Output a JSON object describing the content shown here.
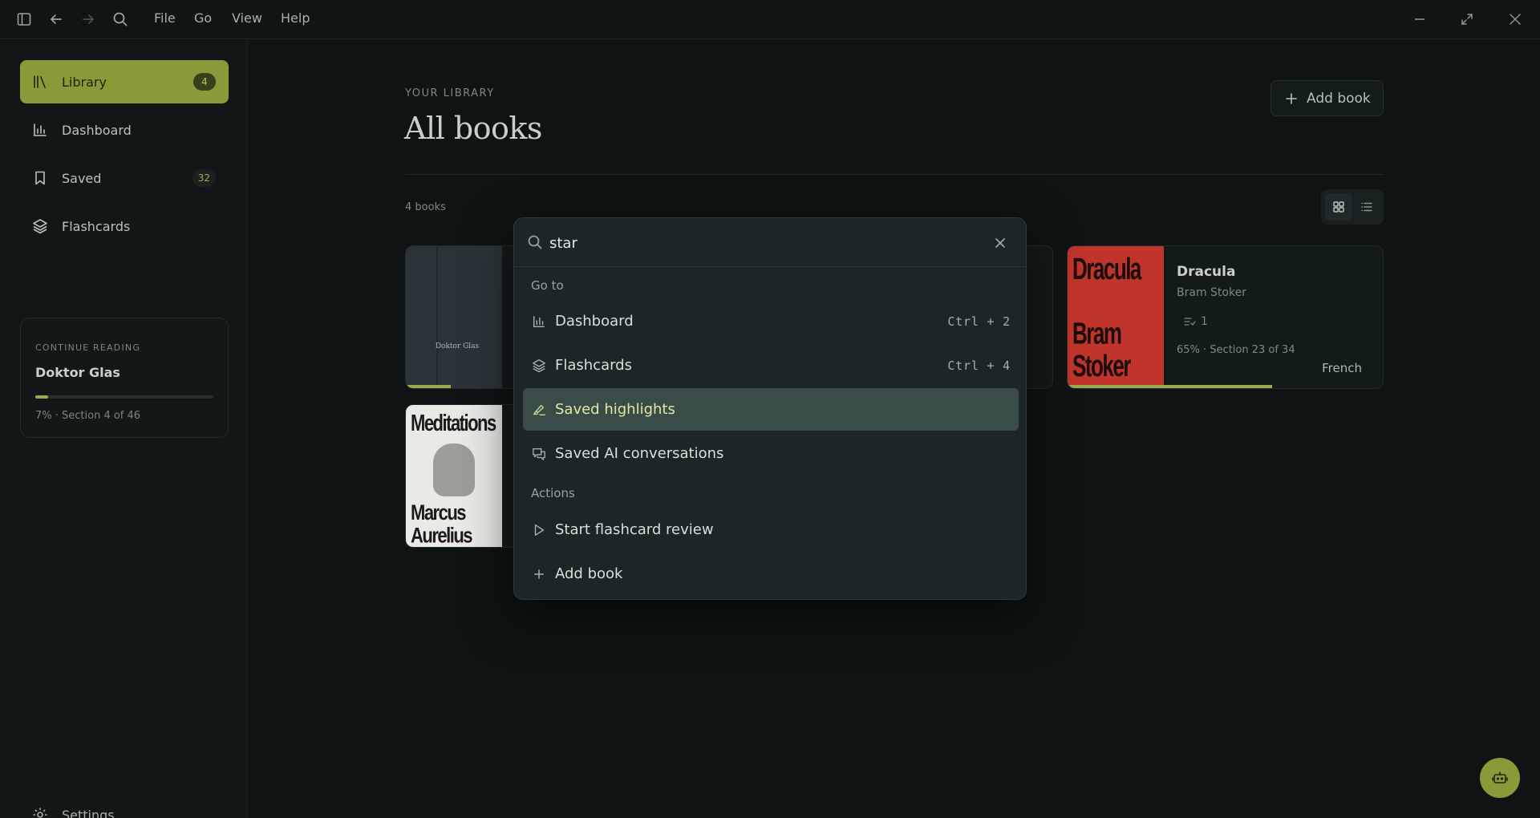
{
  "menu": [
    "File",
    "Go",
    "View",
    "Help"
  ],
  "sidebar": {
    "items": [
      {
        "label": "Library",
        "badge": "4"
      },
      {
        "label": "Dashboard",
        "badge": ""
      },
      {
        "label": "Saved",
        "badge": "32"
      },
      {
        "label": "Flashcards",
        "badge": ""
      }
    ],
    "continue": {
      "kicker": "CONTINUE READING",
      "title": "Doktor Glas",
      "progress": 0.07,
      "subtitle": "7% · Section 4 of 46"
    },
    "settings_label": "Settings"
  },
  "main": {
    "kicker": "YOUR LIBRARY",
    "title": "All books",
    "add_book_label": "Add book",
    "count": "4 books"
  },
  "books": [
    {
      "title": "Dracula",
      "author": "Bram Stoker",
      "cards": "1",
      "progress_text": "65% · Section 23 of 34",
      "language": "French",
      "progress": 0.65,
      "cover_text_1": "Dracula",
      "cover_text_2": "Bram",
      "cover_text_3": "Stoker"
    },
    {
      "cover_title": "Doktor Glas",
      "progress": 0.07
    },
    {
      "cover_text_1": "Meditations",
      "cover_text_2": "Marcus",
      "cover_text_3": "Aurelius"
    }
  ],
  "palette": {
    "query": "star",
    "groups": [
      {
        "label": "Go to",
        "items": [
          {
            "label": "Dashboard",
            "shortcut": "Ctrl + 2",
            "icon": "bar-chart-icon"
          },
          {
            "label": "Flashcards",
            "shortcut": "Ctrl + 4",
            "icon": "layers-icon"
          },
          {
            "label": "Saved highlights",
            "shortcut": "",
            "icon": "highlighter-icon"
          },
          {
            "label": "Saved AI conversations",
            "shortcut": "",
            "icon": "chat-icon"
          }
        ]
      },
      {
        "label": "Actions",
        "items": [
          {
            "label": "Start flashcard review",
            "shortcut": "",
            "icon": "play-icon"
          },
          {
            "label": "Add book",
            "shortcut": "",
            "icon": "plus-icon"
          }
        ]
      }
    ]
  },
  "colors": {
    "accent": "#8a9a38",
    "background": "#0e1313",
    "palette_bg": "#1c2627",
    "selected_row": "#3a4c47"
  }
}
